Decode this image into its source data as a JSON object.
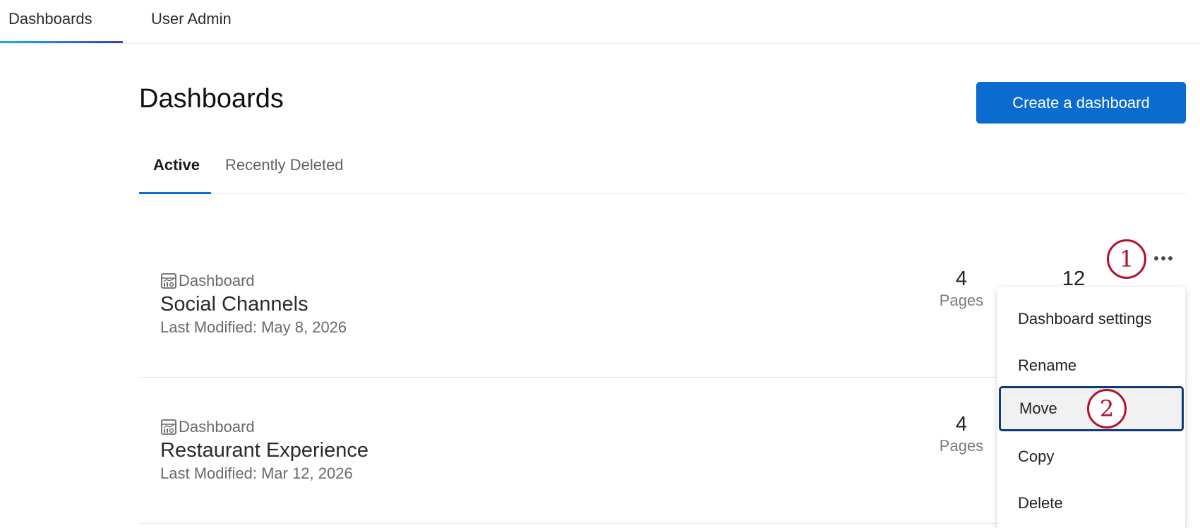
{
  "topnav": {
    "tabs": [
      {
        "label": "Dashboards",
        "active": true
      },
      {
        "label": "User Admin",
        "active": false
      }
    ]
  },
  "page": {
    "title": "Dashboards",
    "create_button": "Create a dashboard"
  },
  "subtabs": [
    {
      "label": "Active",
      "active": true
    },
    {
      "label": "Recently Deleted",
      "active": false
    }
  ],
  "dashboards": [
    {
      "type": "Dashboard",
      "name": "Social Channels",
      "modified": "Last Modified: May 8, 2026",
      "pages": "4",
      "pages_label": "Pages",
      "second_stat": "12"
    },
    {
      "type": "Dashboard",
      "name": "Restaurant Experience",
      "modified": "Last Modified: Mar 12, 2026",
      "pages": "4",
      "pages_label": "Pages"
    }
  ],
  "menu": {
    "items": [
      "Dashboard settings",
      "Rename",
      "Move",
      "Copy",
      "Delete"
    ],
    "highlighted": "Move"
  },
  "callouts": [
    "1",
    "2"
  ],
  "colors": {
    "primary": "#0b6bcf",
    "callout": "#b3102a",
    "focus_outline": "#0e3a76",
    "nav_underline_start": "#14b4e6",
    "nav_underline_end": "#3c3cc8"
  }
}
